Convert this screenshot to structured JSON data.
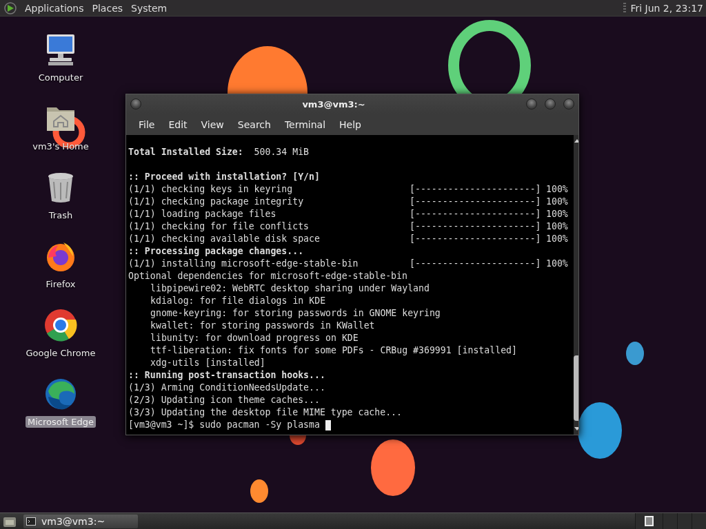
{
  "top_panel": {
    "menus": [
      "Applications",
      "Places",
      "System"
    ],
    "clock": "Fri Jun  2, 23:17"
  },
  "desktop_icons": [
    {
      "label": "Computer",
      "kind": "computer",
      "selected": false
    },
    {
      "label": "vm3's Home",
      "kind": "home",
      "selected": false
    },
    {
      "label": "Trash",
      "kind": "trash",
      "selected": false
    },
    {
      "label": "Firefox",
      "kind": "firefox",
      "selected": false
    },
    {
      "label": "Google Chrome",
      "kind": "chrome",
      "selected": false
    },
    {
      "label": "Microsoft Edge",
      "kind": "edge",
      "selected": true
    }
  ],
  "terminal": {
    "title": "vm3@vm3:~",
    "menu": [
      "File",
      "Edit",
      "View",
      "Search",
      "Terminal",
      "Help"
    ],
    "lines": [
      {
        "kind": "plain",
        "text": "**Total Installed Size:**  500.34 MiB"
      },
      {
        "kind": "blank"
      },
      {
        "kind": "bold",
        "text": ":: Proceed with installation? [Y/n]"
      },
      {
        "kind": "progress",
        "text": "(1/1) checking keys in keyring",
        "bar": "[----------------------]",
        "percent": "100%"
      },
      {
        "kind": "progress",
        "text": "(1/1) checking package integrity",
        "bar": "[----------------------]",
        "percent": "100%"
      },
      {
        "kind": "progress",
        "text": "(1/1) loading package files",
        "bar": "[----------------------]",
        "percent": "100%"
      },
      {
        "kind": "progress",
        "text": "(1/1) checking for file conflicts",
        "bar": "[----------------------]",
        "percent": "100%"
      },
      {
        "kind": "progress",
        "text": "(1/1) checking available disk space",
        "bar": "[----------------------]",
        "percent": "100%"
      },
      {
        "kind": "bold",
        "text": ":: Processing package changes..."
      },
      {
        "kind": "progress",
        "text": "(1/1) installing microsoft-edge-stable-bin",
        "bar": "[----------------------]",
        "percent": "100%"
      },
      {
        "kind": "plain",
        "text": "Optional dependencies for microsoft-edge-stable-bin"
      },
      {
        "kind": "indented",
        "text": "libpipewire02: WebRTC desktop sharing under Wayland"
      },
      {
        "kind": "indented",
        "text": "kdialog: for file dialogs in KDE"
      },
      {
        "kind": "indented",
        "text": "gnome-keyring: for storing passwords in GNOME keyring"
      },
      {
        "kind": "indented",
        "text": "kwallet: for storing passwords in KWallet"
      },
      {
        "kind": "indented",
        "text": "libunity: for download progress on KDE"
      },
      {
        "kind": "indented",
        "text": "ttf-liberation: fix fonts for some PDFs - CRBug #369991 [installed]"
      },
      {
        "kind": "indented",
        "text": "xdg-utils [installed]"
      },
      {
        "kind": "bold",
        "text": ":: Running post-transaction hooks..."
      },
      {
        "kind": "plain",
        "text": "(1/3) Arming ConditionNeedsUpdate..."
      },
      {
        "kind": "plain",
        "text": "(2/3) Updating icon theme caches..."
      },
      {
        "kind": "plain",
        "text": "(3/3) Updating the desktop file MIME type cache..."
      }
    ],
    "prompt": "[vm3@vm3 ~]$ sudo pacman -Sy plasma"
  },
  "taskbar": {
    "tasks": [
      {
        "label": "vm3@vm3:~",
        "selected": true
      }
    ],
    "workspaces": [
      {
        "selected": true
      },
      {
        "selected": false
      },
      {
        "selected": false
      },
      {
        "selected": false
      }
    ]
  }
}
